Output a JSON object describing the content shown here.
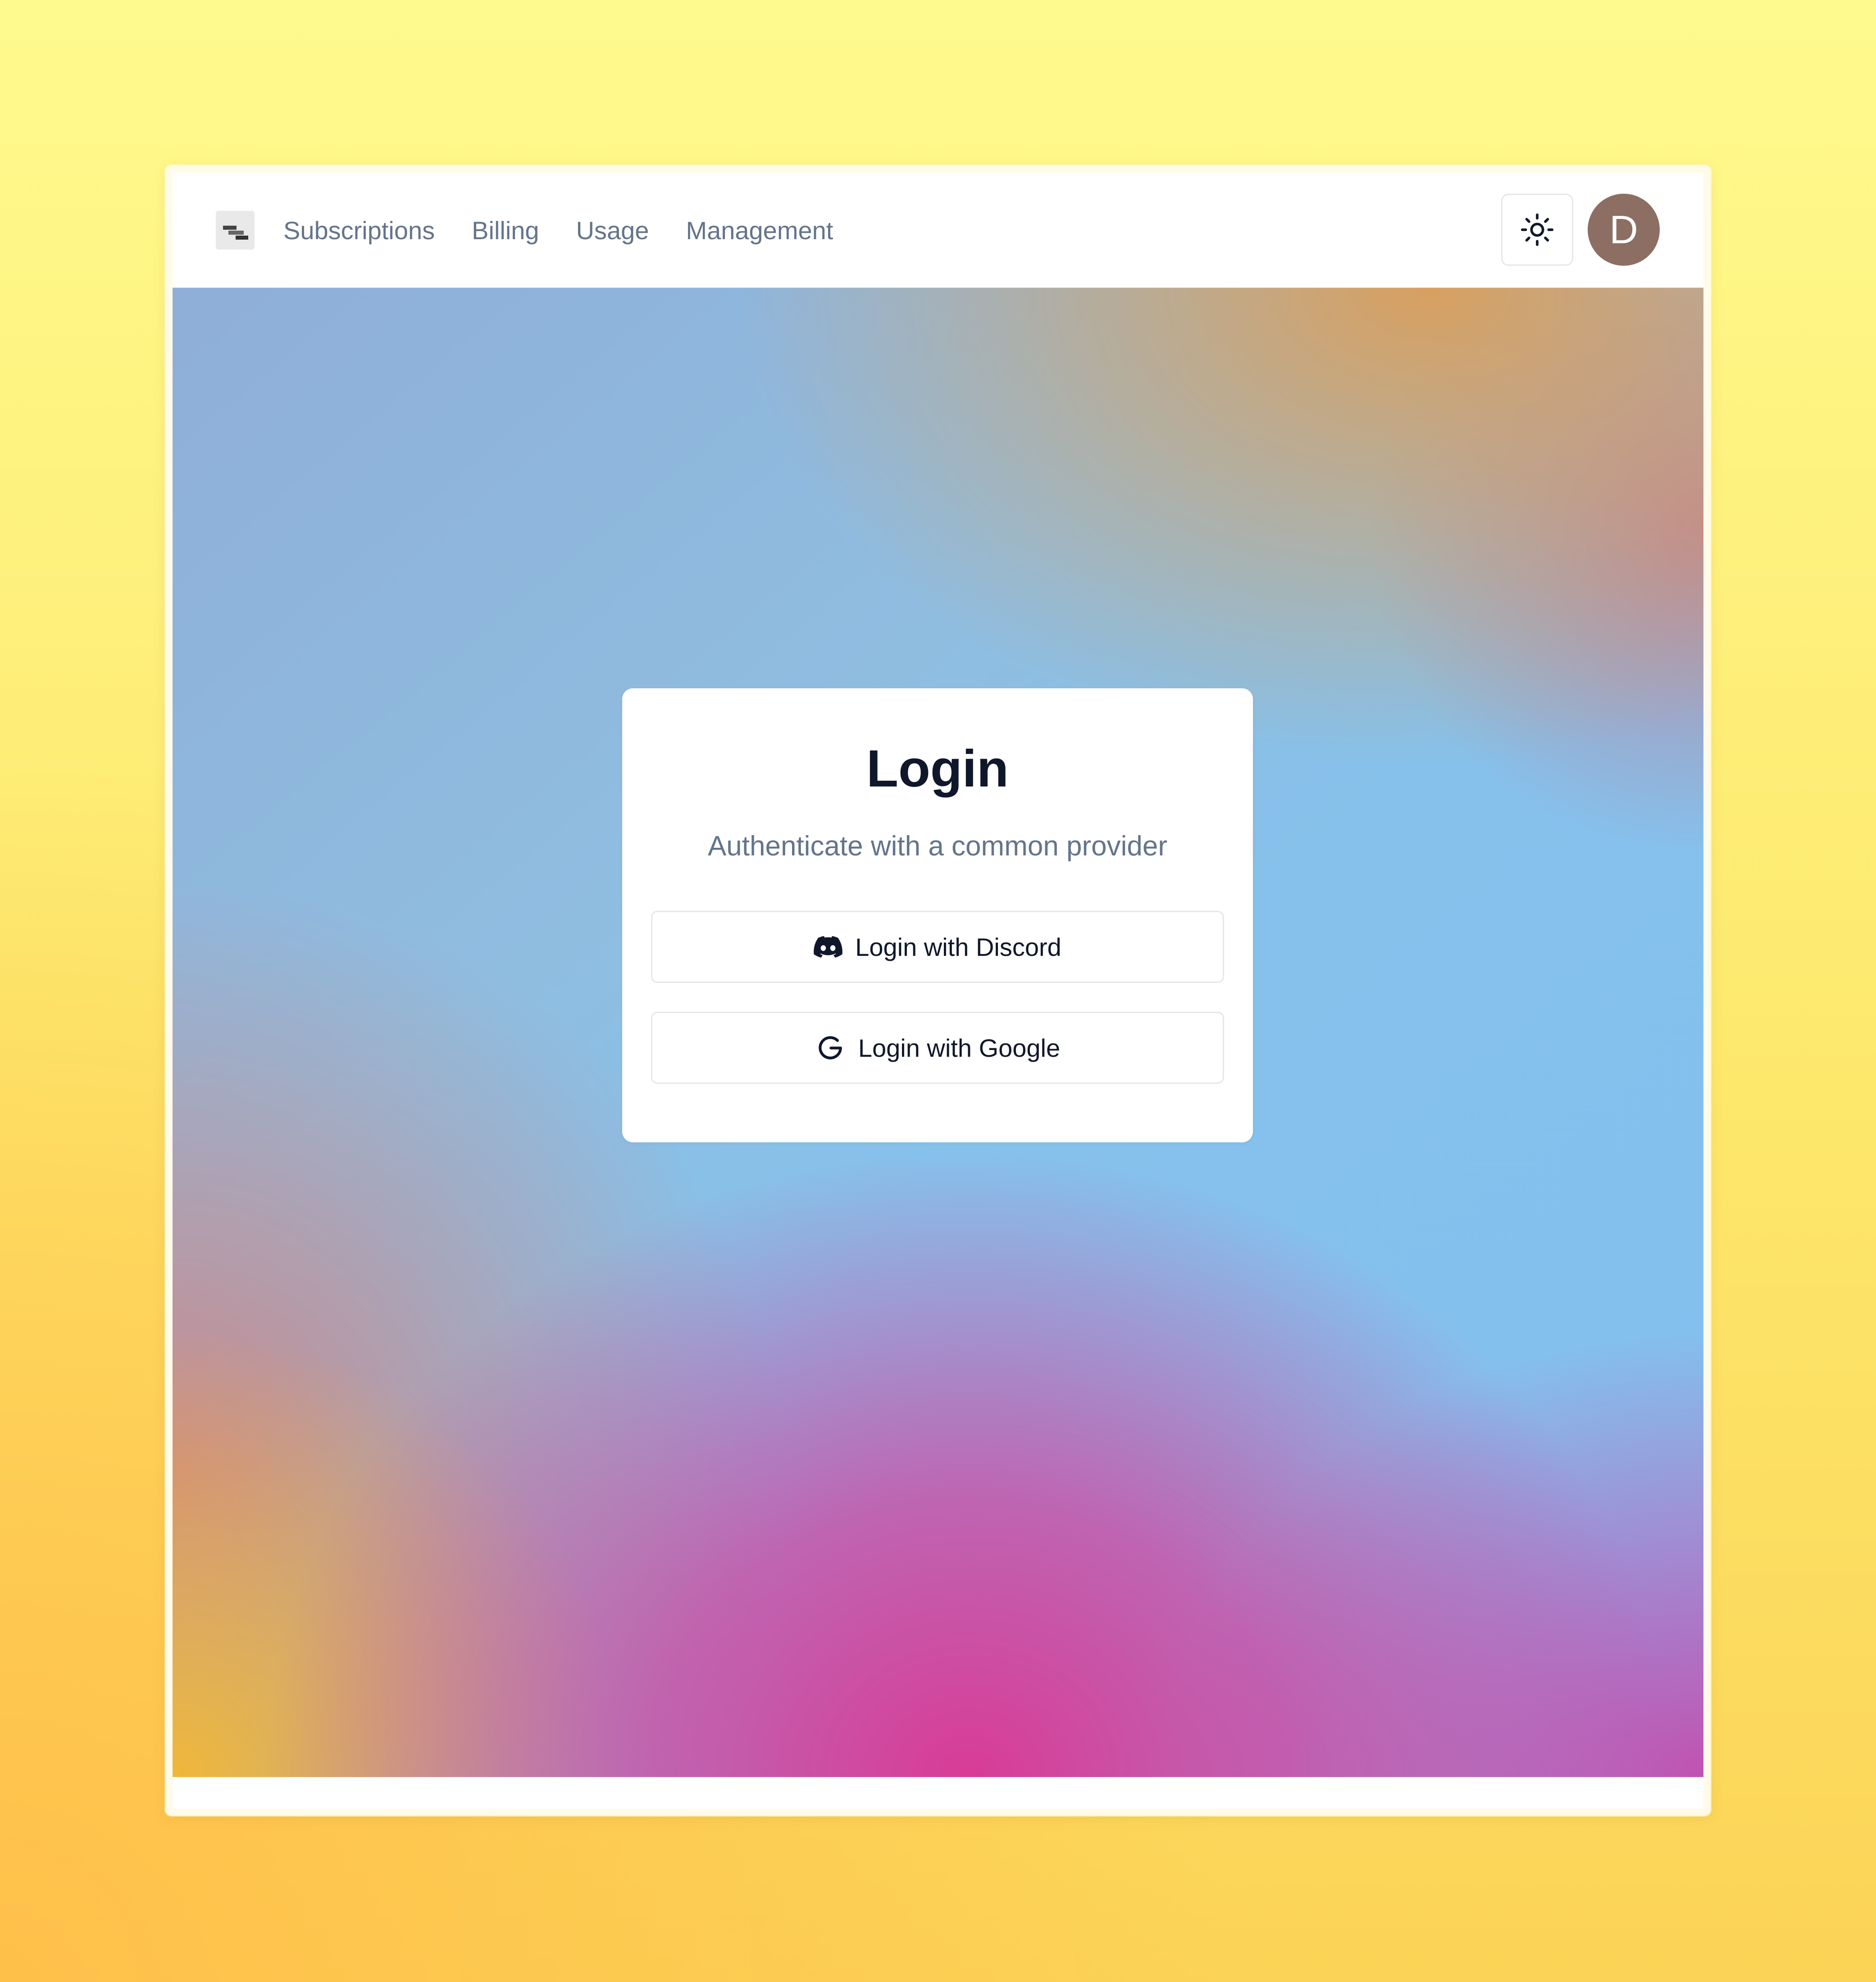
{
  "nav": {
    "links": [
      {
        "label": "Subscriptions"
      },
      {
        "label": "Billing"
      },
      {
        "label": "Usage"
      },
      {
        "label": "Management"
      }
    ],
    "theme_toggle_icon": "sun-icon",
    "avatar_initial": "D",
    "avatar_color": "#8d6e63"
  },
  "login_card": {
    "title": "Login",
    "subtitle": "Authenticate with a common provider",
    "buttons": [
      {
        "label": "Login with Discord",
        "icon": "discord-icon"
      },
      {
        "label": "Login with Google",
        "icon": "google-icon"
      }
    ]
  },
  "colors": {
    "page_background": "#fde86c",
    "hero_pink": "#dd3492",
    "hero_blue": "#82c0f1",
    "text_primary": "#0f172a",
    "text_muted": "#64748b"
  }
}
